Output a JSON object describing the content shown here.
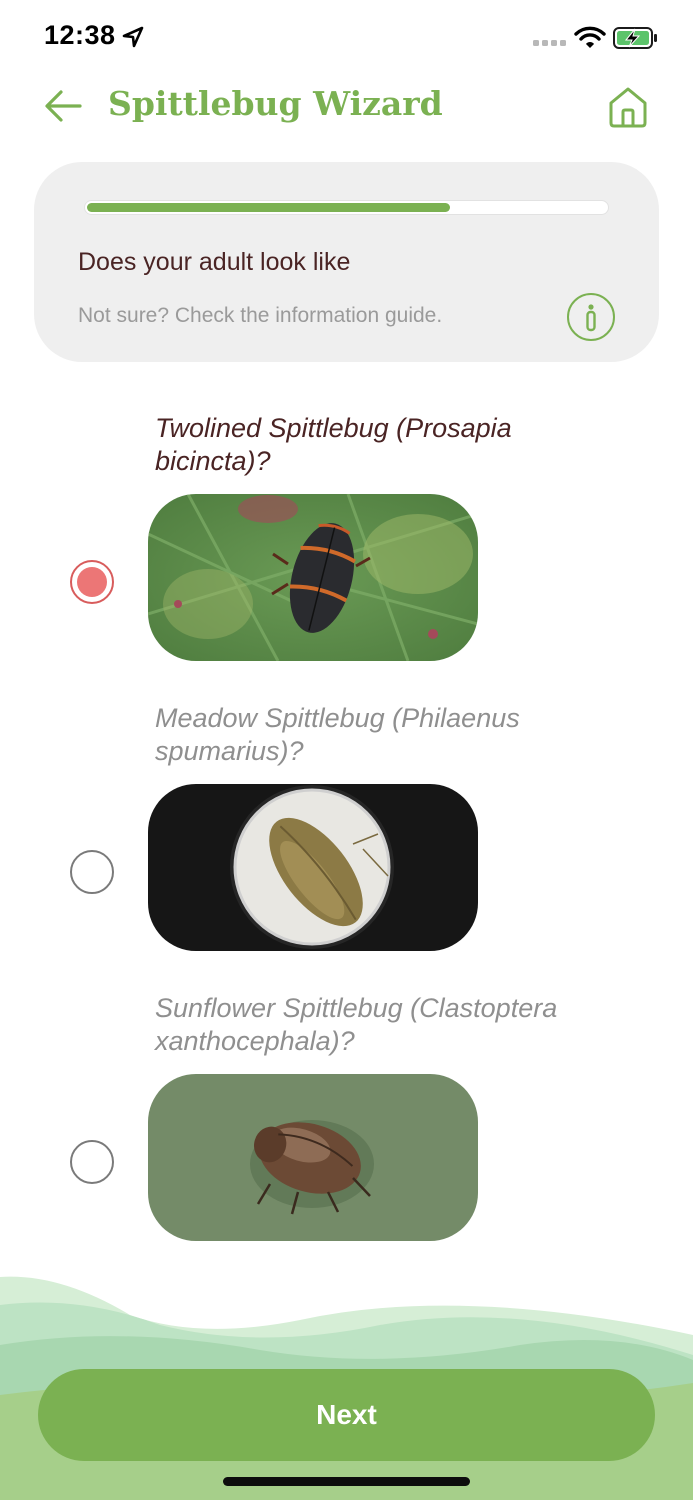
{
  "status_bar": {
    "time": "12:38",
    "location_icon": "location-arrow-icon",
    "signal_icon": "signal-dots-icon",
    "wifi_icon": "wifi-icon",
    "battery_icon": "battery-charging-icon"
  },
  "header": {
    "title": "Spittlebug Wizard",
    "back_icon": "back-arrow-icon",
    "home_icon": "home-icon",
    "accent_color": "#7bb152"
  },
  "question": {
    "progress": 0.7,
    "text": "Does your adult look like",
    "help_text": "Not sure? Check the information guide.",
    "info_icon": "info-icon"
  },
  "options": [
    {
      "label": "Twolined Spittlebug (Prosapia bicincta)?",
      "selected": true
    },
    {
      "label": "Meadow Spittlebug (Philaenus spumarius)?",
      "selected": false
    },
    {
      "label": "Sunflower Spittlebug (Clastoptera xanthocephala)?",
      "selected": false
    }
  ],
  "footer": {
    "next_label": "Next"
  }
}
